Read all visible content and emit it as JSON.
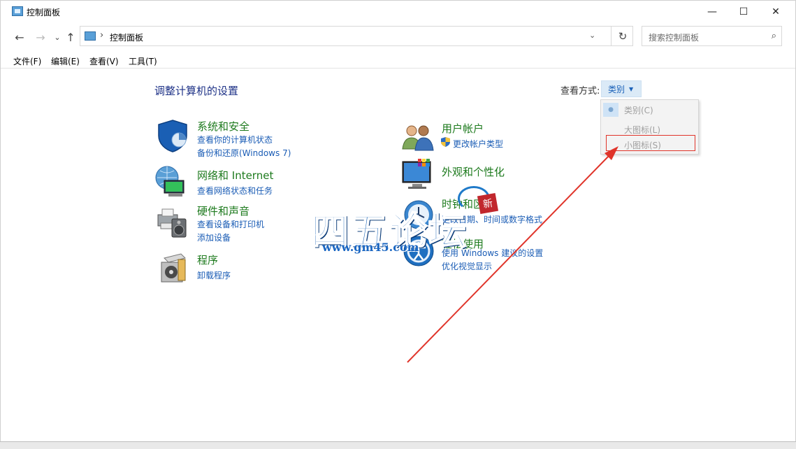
{
  "window": {
    "title": "控制面板",
    "controls": {
      "minimize": "—",
      "maximize": "☐",
      "close": "✕"
    }
  },
  "nav": {
    "back": "←",
    "forward": "→",
    "recent": "⌄",
    "up": "↑",
    "address_sep": "›",
    "address": "控制面板",
    "address_drop": "⌄",
    "refresh": "↻",
    "search_placeholder": "搜索控制面板",
    "search_icon": "⌕"
  },
  "menu": [
    "文件(F)",
    "编辑(E)",
    "查看(V)",
    "工具(T)"
  ],
  "main": {
    "title": "调整计算机的设置",
    "view_by_label": "查看方式:",
    "view_by_value": "类别",
    "view_by_caret": "▼",
    "dropdown": [
      {
        "label": "类别(C)",
        "selected": true,
        "check": "●"
      },
      {
        "label": "大图标(L)",
        "selected": false
      },
      {
        "label": "小图标(S)",
        "selected": false
      }
    ]
  },
  "categories": {
    "left": [
      {
        "title": "系统和安全",
        "links": [
          "查看你的计算机状态",
          "备份和还原(Windows 7)"
        ],
        "icon": "shield-icon"
      },
      {
        "title": "网络和 Internet",
        "links": [
          "查看网络状态和任务"
        ],
        "icon": "network-globe-icon"
      },
      {
        "title": "硬件和声音",
        "links": [
          "查看设备和打印机",
          "添加设备"
        ],
        "icon": "printer-speaker-icon"
      },
      {
        "title": "程序",
        "links": [
          "卸载程序"
        ],
        "icon": "programs-box-icon"
      }
    ],
    "right": [
      {
        "title": "用户帐户",
        "links": [
          "更改帐户类型"
        ],
        "icon": "users-icon"
      },
      {
        "title": "外观和个性化",
        "links": [],
        "icon": "monitor-palette-icon"
      },
      {
        "title": "时钟和区域",
        "links": [
          "更改日期、时间或数字格式"
        ],
        "icon": "clock-globe-icon"
      },
      {
        "title": "轻松使用",
        "links": [
          "使用 Windows 建议的设置",
          "优化视觉显示"
        ],
        "icon": "ease-of-access-icon"
      }
    ]
  },
  "watermark": {
    "text": "四五论坛",
    "url": "www.gm45.com",
    "badge": "新"
  },
  "colors": {
    "title_blue": "#1e3287",
    "category_green": "#1d7a1d",
    "link_blue": "#1a5cb5",
    "highlight_red": "#e0342a"
  }
}
